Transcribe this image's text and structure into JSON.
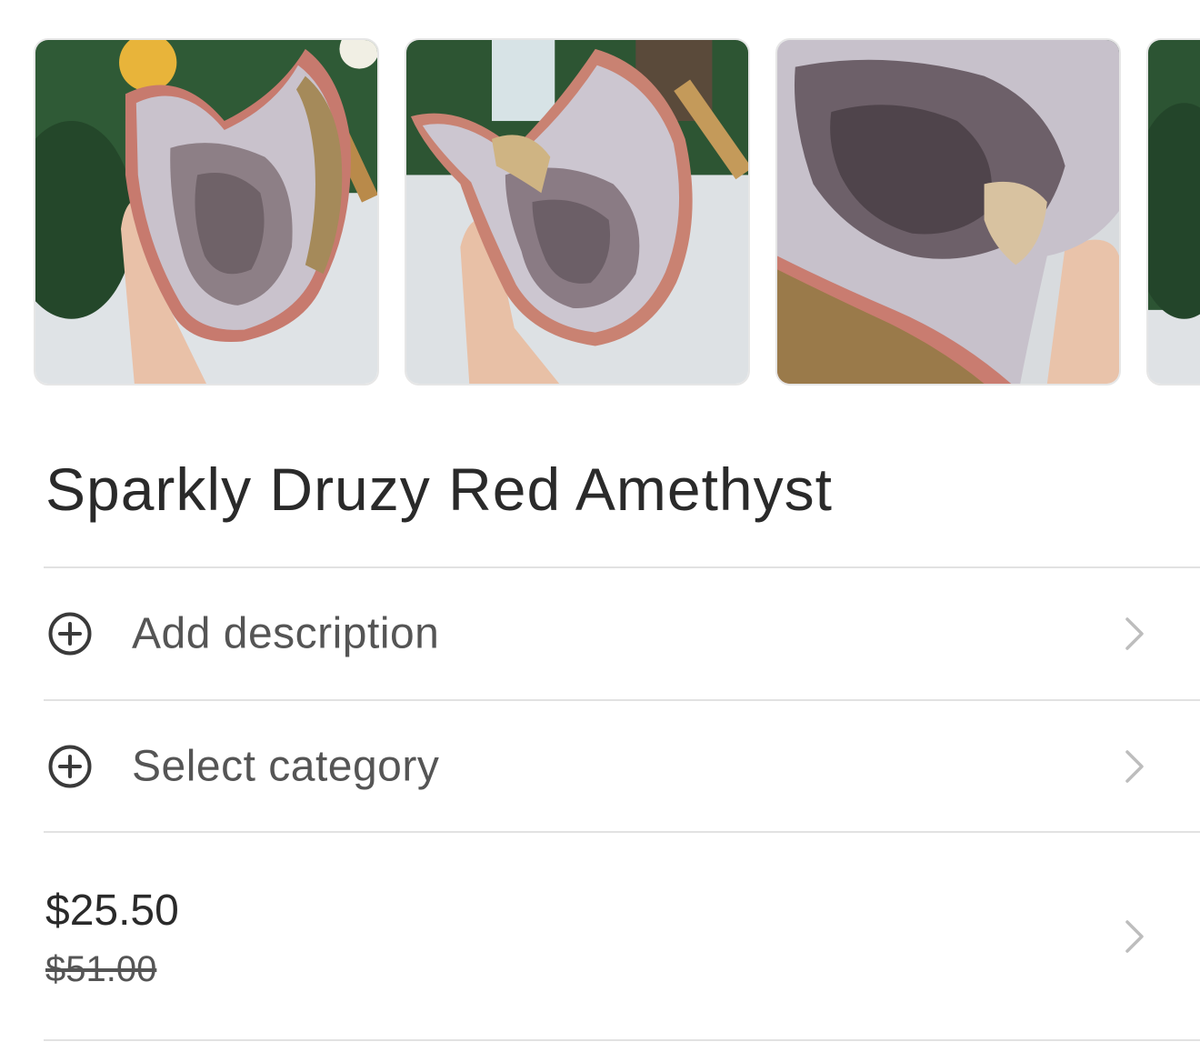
{
  "product": {
    "title": "Sparkly Druzy Red Amethyst"
  },
  "photos": [
    {
      "alt": "geode-photo-1"
    },
    {
      "alt": "geode-photo-2"
    },
    {
      "alt": "geode-photo-3"
    },
    {
      "alt": "geode-photo-4"
    }
  ],
  "rows": {
    "description": {
      "label": "Add description",
      "icon": "plus-circle-icon",
      "trailing_icon": "chevron-right-icon"
    },
    "category": {
      "label": "Select category",
      "icon": "plus-circle-icon",
      "trailing_icon": "chevron-right-icon"
    },
    "price": {
      "current": "$25.50",
      "original": "$51.00",
      "trailing_icon": "chevron-right-icon"
    }
  },
  "colors": {
    "text_primary": "#2a2a2a",
    "text_secondary": "#555555",
    "divider": "#e2e2e2",
    "chevron": "#bdbdbd"
  }
}
